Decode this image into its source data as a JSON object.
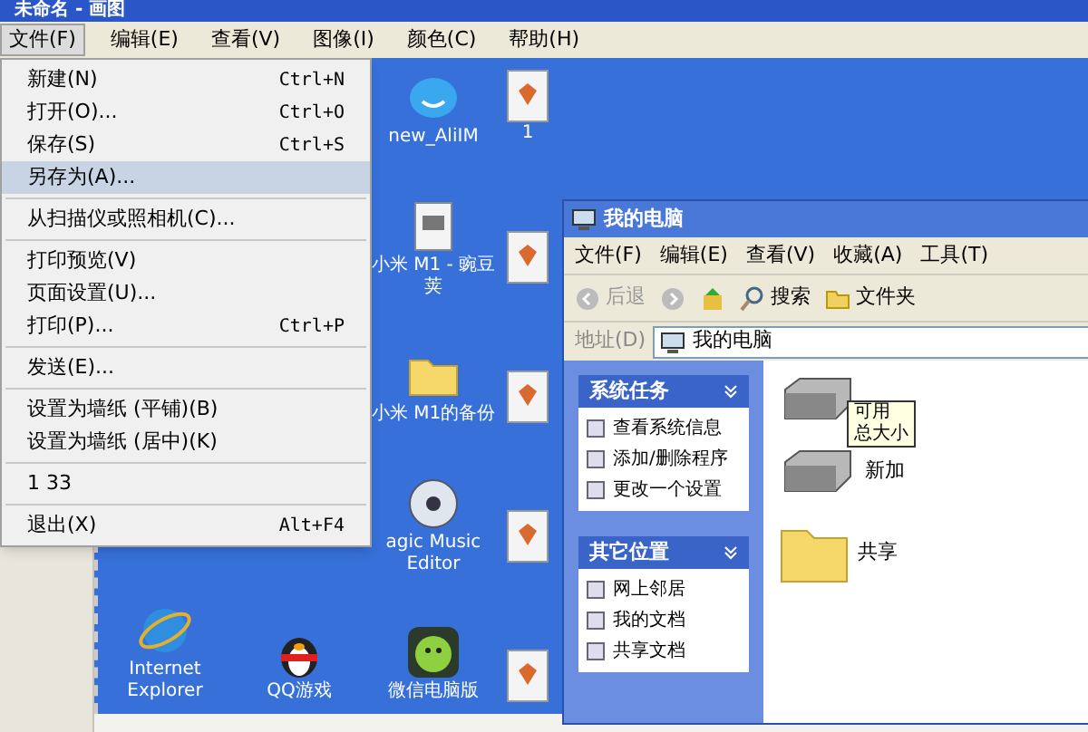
{
  "window": {
    "title": "未命名 - 画图"
  },
  "menu_bar": [
    {
      "label": "文件(F)",
      "selected": true
    },
    {
      "label": "编辑(E)",
      "selected": false
    },
    {
      "label": "查看(V)",
      "selected": false
    },
    {
      "label": "图像(I)",
      "selected": false
    },
    {
      "label": "颜色(C)",
      "selected": false
    },
    {
      "label": "帮助(H)",
      "selected": false
    }
  ],
  "file_menu": [
    {
      "label": "新建(N)",
      "shortcut": "Ctrl+N",
      "selected": false,
      "separator_after": false
    },
    {
      "label": "打开(O)...",
      "shortcut": "Ctrl+O",
      "selected": false,
      "separator_after": false
    },
    {
      "label": "保存(S)",
      "shortcut": "Ctrl+S",
      "selected": false,
      "separator_after": false
    },
    {
      "label": "另存为(A)...",
      "selected": true,
      "separator_after": true
    },
    {
      "label": "从扫描仪或照相机(C)...",
      "selected": false,
      "separator_after": true
    },
    {
      "label": "打印预览(V)",
      "selected": false,
      "separator_after": false
    },
    {
      "label": "页面设置(U)...",
      "selected": false,
      "separator_after": false
    },
    {
      "label": "打印(P)...",
      "shortcut": "Ctrl+P",
      "selected": false,
      "separator_after": true
    },
    {
      "label": "发送(E)...",
      "selected": false,
      "separator_after": true
    },
    {
      "label": "设置为墙纸 (平铺)(B)",
      "selected": false,
      "separator_after": false
    },
    {
      "label": "设置为墙纸 (居中)(K)",
      "selected": false,
      "separator_after": true
    },
    {
      "label": "1 33",
      "selected": false,
      "separator_after": true
    },
    {
      "label": "退出(X)",
      "shortcut": "Alt+F4",
      "selected": false,
      "separator_after": false
    }
  ],
  "desktop_columns": [
    [
      {
        "kind": "browser",
        "label": "Internet Explorer"
      }
    ],
    [
      {
        "kind": "game",
        "label": "QQ游戏"
      }
    ],
    [
      {
        "kind": "chat",
        "label": "new_AliIM"
      },
      {
        "kind": "document",
        "label": "小米 M1 - 豌豆荚"
      },
      {
        "kind": "folder",
        "label": "小米 M1的备份"
      },
      {
        "kind": "disc",
        "label": "agic Music Editor"
      },
      {
        "kind": "app",
        "label": "微信电脑版"
      }
    ],
    [
      {
        "kind": "image",
        "label": "1"
      },
      {
        "kind": "image"
      },
      {
        "kind": "image"
      },
      {
        "kind": "image"
      },
      {
        "kind": "image"
      }
    ]
  ],
  "explorer": {
    "title": "我的电脑",
    "menu": [
      "文件(F)",
      "编辑(E)",
      "查看(V)",
      "收藏(A)",
      "工具(T)"
    ],
    "toolbar": {
      "back": "后退",
      "search": "搜索",
      "folders": "文件夹"
    },
    "address": {
      "label": "地址(D)",
      "value": "我的电脑"
    },
    "panels": [
      {
        "title": "系统任务",
        "items": [
          "查看系统信息",
          "添加/删除程序",
          "更改一个设置"
        ]
      },
      {
        "title": "其它位置",
        "items": [
          "网上邻居",
          "我的文档",
          "共享文档"
        ]
      }
    ],
    "tooltip": [
      "可用",
      "总大小"
    ],
    "items": [
      {
        "kind": "drive"
      },
      {
        "kind": "drive",
        "label": "新加"
      },
      {
        "kind": "folder",
        "label": "共享"
      }
    ]
  }
}
